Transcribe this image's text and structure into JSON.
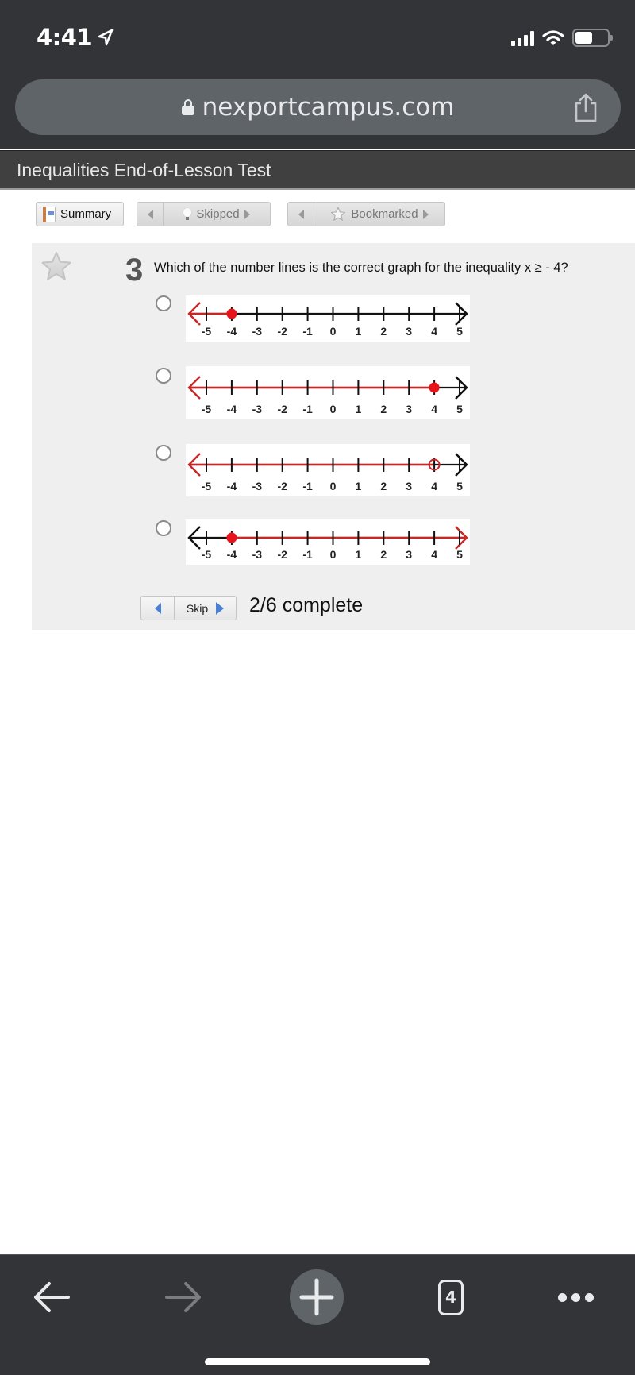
{
  "status_bar": {
    "time": "4:41",
    "location_icon": "location-arrow-icon",
    "signal_bars": 4,
    "wifi_icon": "wifi-icon",
    "battery_level": 0.55
  },
  "browser": {
    "url": "nexportcampus.com",
    "secure_icon": "lock-icon",
    "share_icon": "share-icon"
  },
  "page": {
    "title": "Inequalities End-of-Lesson Test"
  },
  "toolbar": {
    "summary_label": "Summary",
    "skipped_label": "Skipped",
    "bookmarked_label": "Bookmarked"
  },
  "question": {
    "number": "3",
    "text": "Which of the number lines is the correct graph for the inequality x ≥ - 4?",
    "bookmark_icon": "star-icon",
    "number_line_ticks": [
      "-5",
      "-4",
      "-3",
      "-2",
      "-1",
      "0",
      "1",
      "2",
      "3",
      "4",
      "5"
    ],
    "options": [
      {
        "point": -4,
        "point_style": "closed",
        "shaded_direction": "left",
        "selected": false
      },
      {
        "point": 4,
        "point_style": "closed",
        "shaded_direction": "left",
        "selected": false
      },
      {
        "point": 4,
        "point_style": "open",
        "shaded_direction": "left",
        "selected": false
      },
      {
        "point": -4,
        "point_style": "closed",
        "shaded_direction": "right",
        "selected": false
      }
    ],
    "colors": {
      "shade": "#c62828",
      "point": "#e8141b",
      "axis": "#111111"
    }
  },
  "navigation": {
    "skip_label": "Skip",
    "progress_text": "2/6 complete",
    "progress_fraction": 0.333
  },
  "bottom_toolbar": {
    "back_icon": "arrow-left-icon",
    "forward_icon": "arrow-right-icon",
    "new_tab_icon": "plus-icon",
    "tab_count": "4",
    "more_icon": "more-dots-icon"
  }
}
